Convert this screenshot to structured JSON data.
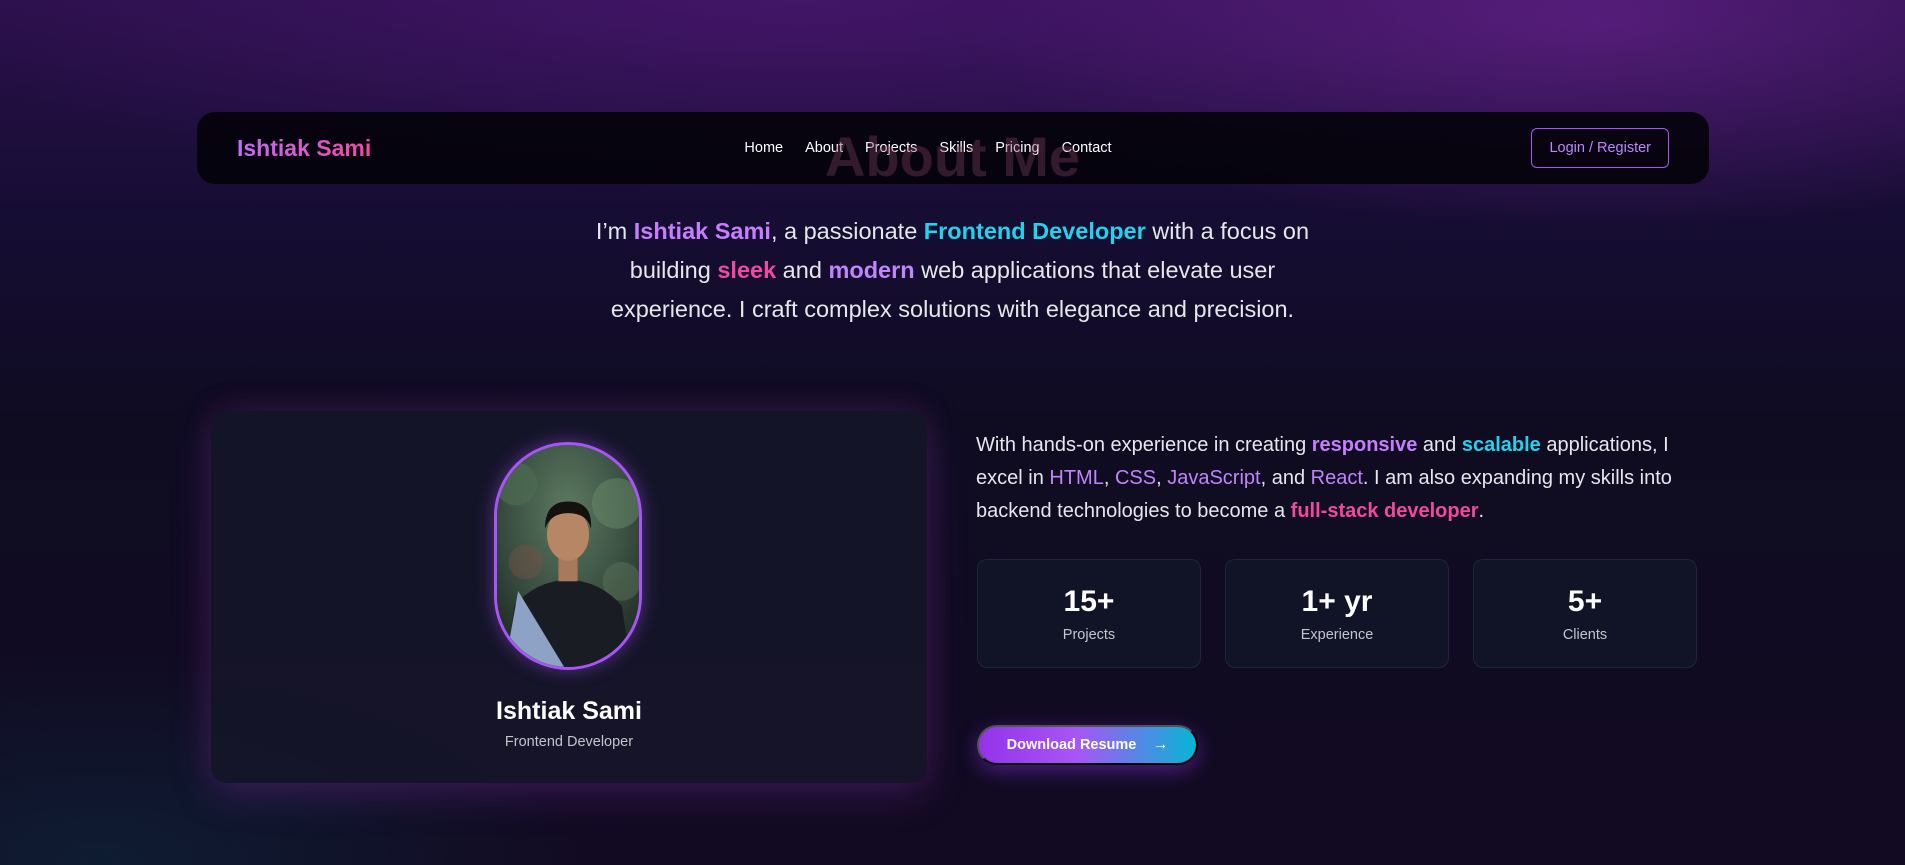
{
  "nav": {
    "brand": "Ishtiak Sami",
    "links": [
      "Home",
      "About",
      "Projects",
      "Skills",
      "Pricing",
      "Contact"
    ],
    "login_label": "Login / Register"
  },
  "section_heading": "About Me",
  "intro": {
    "p1": "I’m ",
    "name": "Ishtiak Sami",
    "p2": ", a passionate ",
    "role": "Frontend Developer",
    "p3": " with a focus on building ",
    "w1": "sleek",
    "p4": " and ",
    "w2": "modern",
    "p5": " web applications that elevate user experience. I craft complex solutions with elegance and precision."
  },
  "profile": {
    "name": "Ishtiak Sami",
    "role": "Frontend Developer"
  },
  "about": {
    "t1": "With hands-on experience in creating ",
    "w1": "responsive",
    "t2": " and ",
    "w2": "scalable",
    "t3": " applications, I excel in ",
    "tech1": "HTML",
    "s1": ", ",
    "tech2": "CSS",
    "s2": ", ",
    "tech3": "JavaScript",
    "s3": ", and ",
    "tech4": "React",
    "t4": ". I am also expanding my skills into backend technologies to become a ",
    "w3": "full-stack developer",
    "t5": "."
  },
  "stats": [
    {
      "value": "15+",
      "label": "Projects"
    },
    {
      "value": "1+ yr",
      "label": "Experience"
    },
    {
      "value": "5+",
      "label": "Clients"
    }
  ],
  "download_label": "Download Resume",
  "icons": {
    "download_arrow": "arrow-right-icon"
  },
  "colors": {
    "accent_purple": "#a855f7",
    "accent_pink": "#f0499f",
    "accent_cyan": "#22d3ee"
  }
}
